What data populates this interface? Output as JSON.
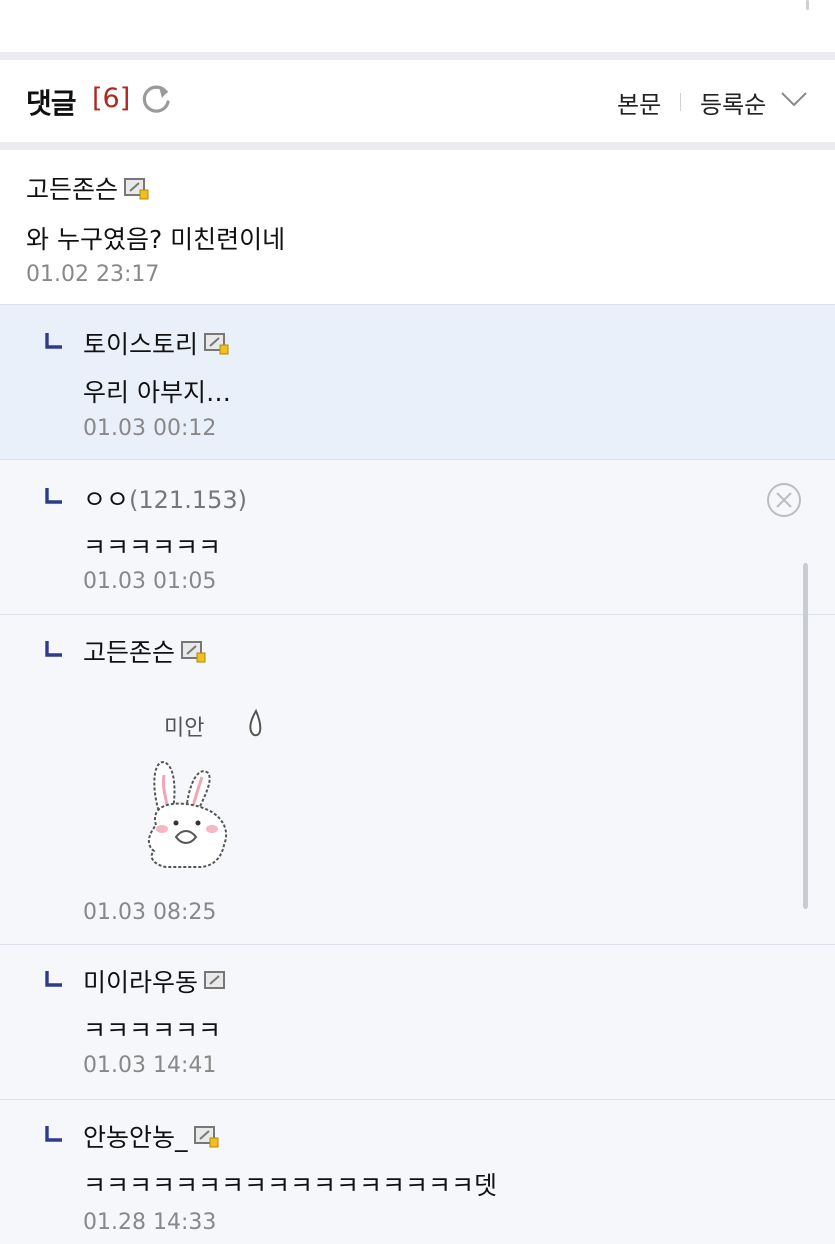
{
  "comments_header": {
    "title": "댓글",
    "count": "[6]",
    "tabs": {
      "body": "본문",
      "sort": "등록순"
    }
  },
  "comments": [
    {
      "author": "고든존슨",
      "text": "와 누구였음? 미친련이네",
      "time": "01.02 23:17"
    },
    {
      "author": "토이스토리",
      "text": "우리 아부지…",
      "time": "01.03 00:12"
    },
    {
      "author": "ㅇㅇ",
      "ip": "(121.153)",
      "text": "ㅋㅋㅋㅋㅋㅋ",
      "time": "01.03 01:05"
    },
    {
      "author": "고든존슨",
      "sticker_text": "미안",
      "time": "01.03 08:25"
    },
    {
      "author": "미이라우동",
      "text": "ㅋㅋㅋㅋㅋㅋ",
      "time": "01.03 14:41"
    },
    {
      "author": "안농안농_",
      "text": "ㅋㅋㅋㅋㅋㅋㅋㅋㅋㅋㅋㅋㅋㅋㅋㅋㅋ뎃",
      "time": "01.28 14:33"
    }
  ],
  "colors": {
    "count_red": "#b3261e",
    "reply_mark": "#2f3a8f",
    "highlight_bg": "#eaf0fa",
    "reply_bg": "#f6f7fa"
  },
  "icons": [
    "refresh-icon",
    "chevron-down-icon",
    "memo-icon",
    "reply-arrow-icon",
    "delete-icon"
  ]
}
